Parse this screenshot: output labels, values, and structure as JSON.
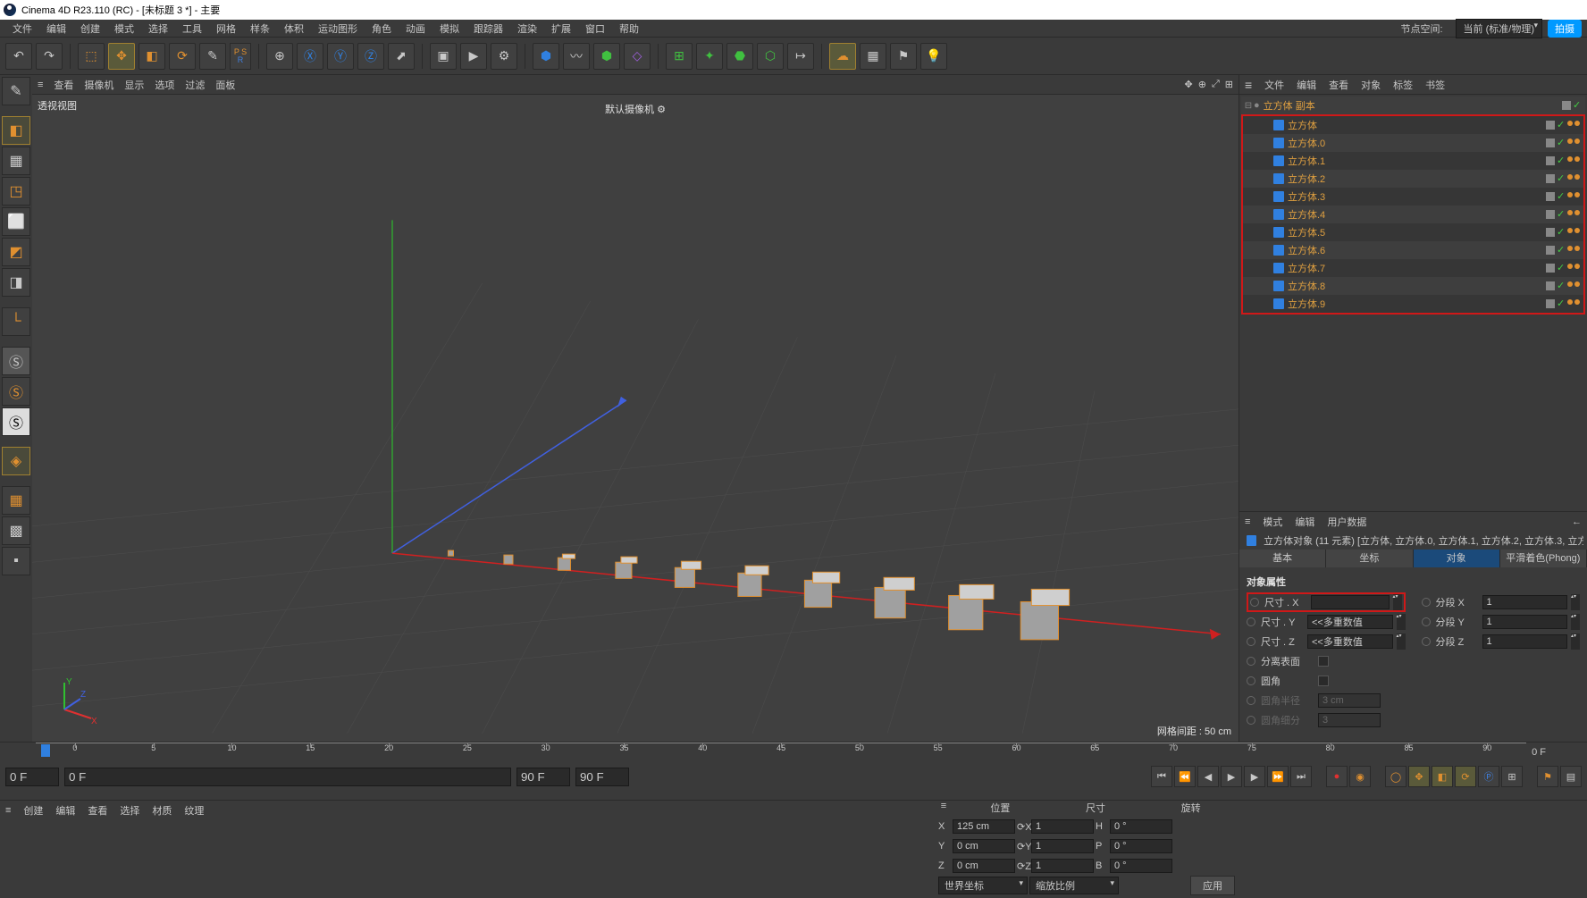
{
  "titlebar": {
    "text": "Cinema 4D R23.110 (RC) - [未标题 3 *] - 主要"
  },
  "menubar": {
    "items": [
      "文件",
      "编辑",
      "创建",
      "模式",
      "选择",
      "工具",
      "网格",
      "样条",
      "体积",
      "运动图形",
      "角色",
      "动画",
      "模拟",
      "跟踪器",
      "渲染",
      "扩展",
      "窗口",
      "帮助"
    ],
    "node_space_label": "节点空间:",
    "node_space_value": "当前 (标准/物理)",
    "upload": "拍摄"
  },
  "viewport_menu": {
    "items": [
      "查看",
      "摄像机",
      "显示",
      "选项",
      "过滤",
      "面板"
    ],
    "view_name": "透视视图",
    "camera": "默认摄像机",
    "grid_status": "网格间距 : 50 cm"
  },
  "object_panel": {
    "tabs": [
      "文件",
      "编辑",
      "查看",
      "对象",
      "标签",
      "书签"
    ],
    "root": {
      "name": "立方体 副本"
    },
    "children": [
      {
        "name": "立方体"
      },
      {
        "name": "立方体.0"
      },
      {
        "name": "立方体.1"
      },
      {
        "name": "立方体.2"
      },
      {
        "name": "立方体.3"
      },
      {
        "name": "立方体.4"
      },
      {
        "name": "立方体.5"
      },
      {
        "name": "立方体.6"
      },
      {
        "name": "立方体.7"
      },
      {
        "name": "立方体.8"
      },
      {
        "name": "立方体.9"
      }
    ]
  },
  "attributes": {
    "head": [
      "模式",
      "编辑",
      "用户数据"
    ],
    "title": "立方体对象 (11 元素) [立方体, 立方体.0, 立方体.1, 立方体.2, 立方体.3, 立方体.…",
    "tabs": [
      "基本",
      "坐标",
      "对象",
      "平滑着色(Phong)"
    ],
    "section": "对象属性",
    "size_x_label": "尺寸 . X",
    "size_x_value": "",
    "size_y_label": "尺寸 . Y",
    "size_y_value": "<<多重数值",
    "size_z_label": "尺寸 . Z",
    "size_z_value": "<<多重数值",
    "seg_x_label": "分段 X",
    "seg_x_value": "1",
    "seg_y_label": "分段 Y",
    "seg_y_value": "1",
    "seg_z_label": "分段 Z",
    "seg_z_value": "1",
    "separate_label": "分离表面",
    "fillet_label": "圆角",
    "fillet_r_label": "圆角半径",
    "fillet_r_value": "3 cm",
    "fillet_sub_label": "圆角细分",
    "fillet_sub_value": "3"
  },
  "timeline": {
    "ticks": [
      "0",
      "5",
      "10",
      "15",
      "20",
      "25",
      "30",
      "35",
      "40",
      "45",
      "50",
      "55",
      "60",
      "65",
      "70",
      "75",
      "80",
      "85",
      "90"
    ],
    "end_label": "0 F",
    "start_field": "0 F",
    "start_field2": "0 F",
    "end_field": "90 F",
    "end_field2": "90 F"
  },
  "coords": {
    "headers_ham": "≡",
    "pos": "位置",
    "size": "尺寸",
    "rot": "旋转",
    "x": "X",
    "y": "Y",
    "z": "Z",
    "px": "125 cm",
    "py": "0 cm",
    "pz": "0 cm",
    "sx": "1",
    "sy": "1",
    "sz": "1",
    "rh_l": "H",
    "rp_l": "P",
    "rb_l": "B",
    "rh": "0 °",
    "rp": "0 °",
    "rb": "0 °",
    "world": "世界坐标",
    "scale_mode": "缩放比例",
    "apply": "应用"
  },
  "material_bar": {
    "items": [
      "创建",
      "编辑",
      "查看",
      "选择",
      "材质",
      "纹理"
    ]
  }
}
